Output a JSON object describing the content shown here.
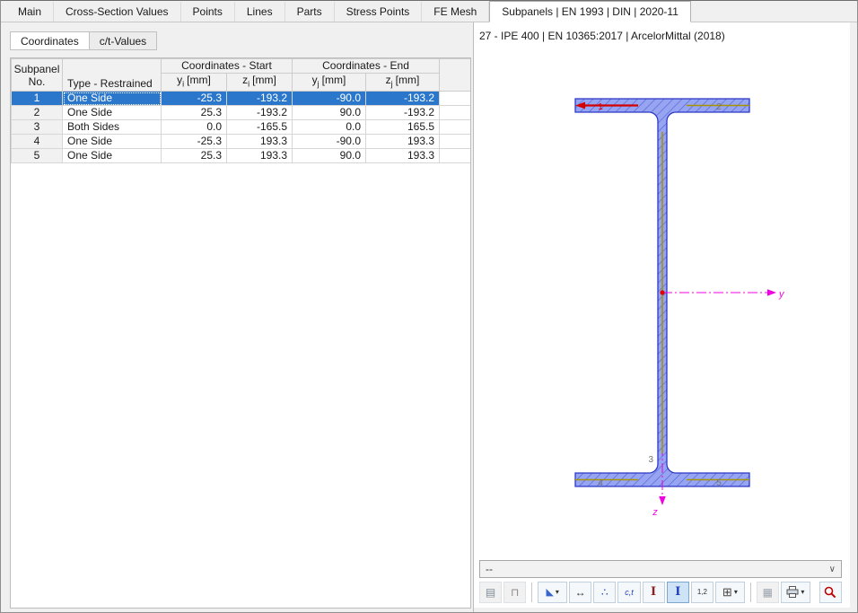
{
  "tabs": [
    "Main",
    "Cross-Section Values",
    "Points",
    "Lines",
    "Parts",
    "Stress Points",
    "FE Mesh",
    "Subpanels | EN 1993 | DIN | 2020-11"
  ],
  "subtabs": [
    "Coordinates",
    "c/t-Values"
  ],
  "table": {
    "headers": {
      "subpanel_line1": "Subpanel",
      "subpanel_line2": "No.",
      "type": "Type - Restrained",
      "coords_start": "Coordinates - Start",
      "coords_end": "Coordinates - End",
      "yi": {
        "v": "y",
        "s": "i",
        "u": "[mm]"
      },
      "zi": {
        "v": "z",
        "s": "i",
        "u": "[mm]"
      },
      "yj": {
        "v": "y",
        "s": "j",
        "u": "[mm]"
      },
      "zj": {
        "v": "z",
        "s": "j",
        "u": "[mm]"
      }
    },
    "rows": [
      {
        "no": "1",
        "type": "One Side",
        "yi": "-25.3",
        "zi": "-193.2",
        "yj": "-90.0",
        "zj": "-193.2"
      },
      {
        "no": "2",
        "type": "One Side",
        "yi": "25.3",
        "zi": "-193.2",
        "yj": "90.0",
        "zj": "-193.2"
      },
      {
        "no": "3",
        "type": "Both Sides",
        "yi": "0.0",
        "zi": "-165.5",
        "yj": "0.0",
        "zj": "165.5"
      },
      {
        "no": "4",
        "type": "One Side",
        "yi": "-25.3",
        "zi": "193.3",
        "yj": "-90.0",
        "zj": "193.3"
      },
      {
        "no": "5",
        "type": "One Side",
        "yi": "25.3",
        "zi": "193.3",
        "yj": "90.0",
        "zj": "193.3"
      }
    ]
  },
  "viewer": {
    "title": "27 - IPE 400 | EN 10365:2017 | ArcelorMittal (2018)",
    "axes": {
      "y": "y",
      "z": "z"
    },
    "marks": [
      "1",
      "2",
      "3",
      "4",
      "5"
    ],
    "dropdown_value": "--",
    "dropdown_chevron": "∨",
    "colors": {
      "section_fill": "#96a4f2",
      "section_hatch": "#5060d0",
      "section_edge": "#2a38c8",
      "axis": "#f000e0",
      "selected_subpanel": "#d40000",
      "subpanel_line": "#a89300",
      "row_selection": "#2a77cc"
    }
  },
  "toolbar": {
    "dropdown_glyph": "▾",
    "buttons": [
      {
        "name": "copy-table",
        "glyph": "▤"
      },
      {
        "name": "clip",
        "glyph": "⊓"
      },
      {
        "name": "stress-diagram",
        "glyph": "◣"
      },
      {
        "name": "dimensions",
        "glyph": "↔"
      },
      {
        "name": "stress-points",
        "glyph": "∴"
      },
      {
        "name": "ct-parts",
        "glyph": "c,t"
      },
      {
        "name": "parts",
        "glyph": "I"
      },
      {
        "name": "subpanels",
        "glyph": "I"
      },
      {
        "name": "numbering",
        "glyph": "1,2"
      },
      {
        "name": "table-layout",
        "glyph": "⊞"
      },
      {
        "name": "grid",
        "glyph": "▦"
      },
      {
        "name": "print",
        "glyph": ""
      },
      {
        "name": "zoom-reset",
        "glyph": ""
      }
    ]
  }
}
